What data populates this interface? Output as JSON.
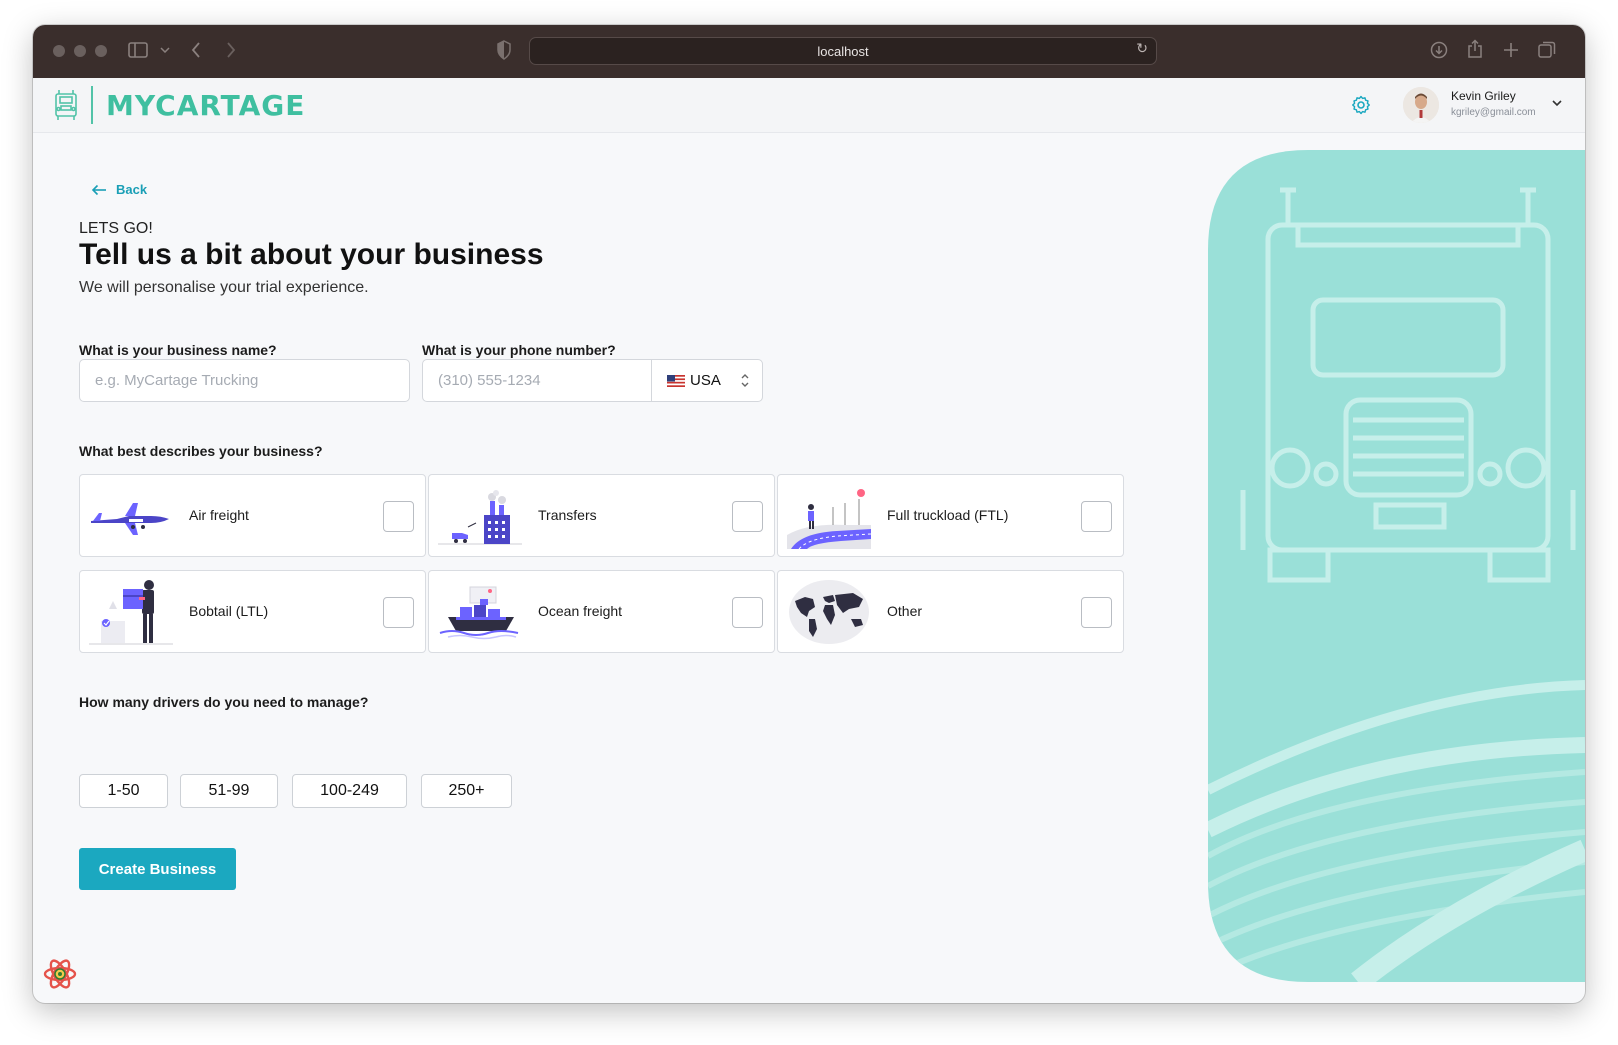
{
  "browser": {
    "url": "localhost"
  },
  "brand": {
    "name": "MYCARTAGE",
    "accent": "#3fbfa0"
  },
  "user": {
    "name": "Kevin Griley",
    "email": "kgriley@gmail.com"
  },
  "page": {
    "back_label": "Back",
    "eyebrow": "LETS GO!",
    "title": "Tell us a bit about your business",
    "subtitle": "We will personalise your trial experience."
  },
  "form": {
    "business_name": {
      "label": "What is your business name?",
      "placeholder": "e.g. MyCartage Trucking",
      "value": ""
    },
    "phone": {
      "label": "What is your phone number?",
      "placeholder": "(310) 555-1234",
      "value": "",
      "country": "USA"
    },
    "business_type": {
      "label": "What best describes your business?",
      "options": [
        {
          "label": "Air freight",
          "icon": "airplane-illustration",
          "checked": false
        },
        {
          "label": "Transfers",
          "icon": "factory-illustration",
          "checked": false
        },
        {
          "label": "Full truckload (FTL)",
          "icon": "road-illustration",
          "checked": false
        },
        {
          "label": "Bobtail (LTL)",
          "icon": "person-boxes-illustration",
          "checked": false
        },
        {
          "label": "Ocean freight",
          "icon": "cargo-ship-illustration",
          "checked": false
        },
        {
          "label": "Other",
          "icon": "world-map-illustration",
          "checked": false
        }
      ]
    },
    "drivers": {
      "label": "How many drivers do you need to manage?",
      "options": [
        "1-50",
        "51-99",
        "100-249",
        "250+"
      ]
    },
    "submit_label": "Create Business"
  },
  "colors": {
    "primary": "#1ba8c0",
    "panel": "#9ae0d8",
    "illustration": "#6c63ff"
  }
}
